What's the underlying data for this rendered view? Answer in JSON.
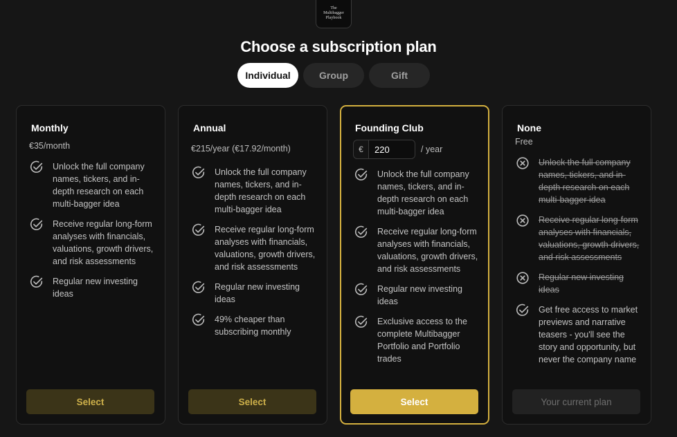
{
  "logo": {
    "lines": [
      "The",
      "Multibagger",
      "Playbook"
    ]
  },
  "title": "Choose a subscription plan",
  "tabs": [
    {
      "label": "Individual",
      "active": true
    },
    {
      "label": "Group",
      "active": false
    },
    {
      "label": "Gift",
      "active": false
    }
  ],
  "plans": [
    {
      "name": "Monthly",
      "price": "€35/month",
      "features": [
        {
          "text": "Unlock the full company names, tickers, and in-depth research on each multi-bagger idea",
          "included": true
        },
        {
          "text": "Receive regular long-form analyses with financials, valuations, growth drivers, and risk assessments",
          "included": true
        },
        {
          "text": "Regular new investing ideas",
          "included": true
        }
      ],
      "cta": "Select"
    },
    {
      "name": "Annual",
      "price": "€215/year (€17.92/month)",
      "features": [
        {
          "text": "Unlock the full company names, tickers, and in-depth research on each multi-bagger idea",
          "included": true
        },
        {
          "text": "Receive regular long-form analyses with financials, valuations, growth drivers, and risk assessments",
          "included": true
        },
        {
          "text": "Regular new investing ideas",
          "included": true
        },
        {
          "text": "49% cheaper than subscribing monthly",
          "included": true
        }
      ],
      "cta": "Select"
    },
    {
      "name": "Founding Club",
      "currency": "€",
      "amount": "220",
      "period": "/ year",
      "features": [
        {
          "text": "Unlock the full company names, tickers, and in-depth research on each multi-bagger idea",
          "included": true
        },
        {
          "text": "Receive regular long-form analyses with financials, valuations, growth drivers, and risk assessments",
          "included": true
        },
        {
          "text": "Regular new investing ideas",
          "included": true
        },
        {
          "text": "Exclusive access to the complete Multibagger Portfolio and Portfolio trades",
          "included": true
        }
      ],
      "cta": "Select"
    },
    {
      "name": "None",
      "price": "Free",
      "features": [
        {
          "text": "Unlock the full company names, tickers, and in-depth research on each multi-bagger idea",
          "included": false
        },
        {
          "text": "Receive regular long-form analyses with financials, valuations, growth drivers, and risk assessments",
          "included": false
        },
        {
          "text": "Regular new investing ideas",
          "included": false
        },
        {
          "text": "Get free access to market previews and narrative teasers - you'll see the story and opportunity, but never the company name",
          "included": true
        }
      ],
      "cta": "Your current plan"
    }
  ],
  "colors": {
    "accent": "#d4b03f",
    "background": "#161616",
    "card": "#111111"
  }
}
